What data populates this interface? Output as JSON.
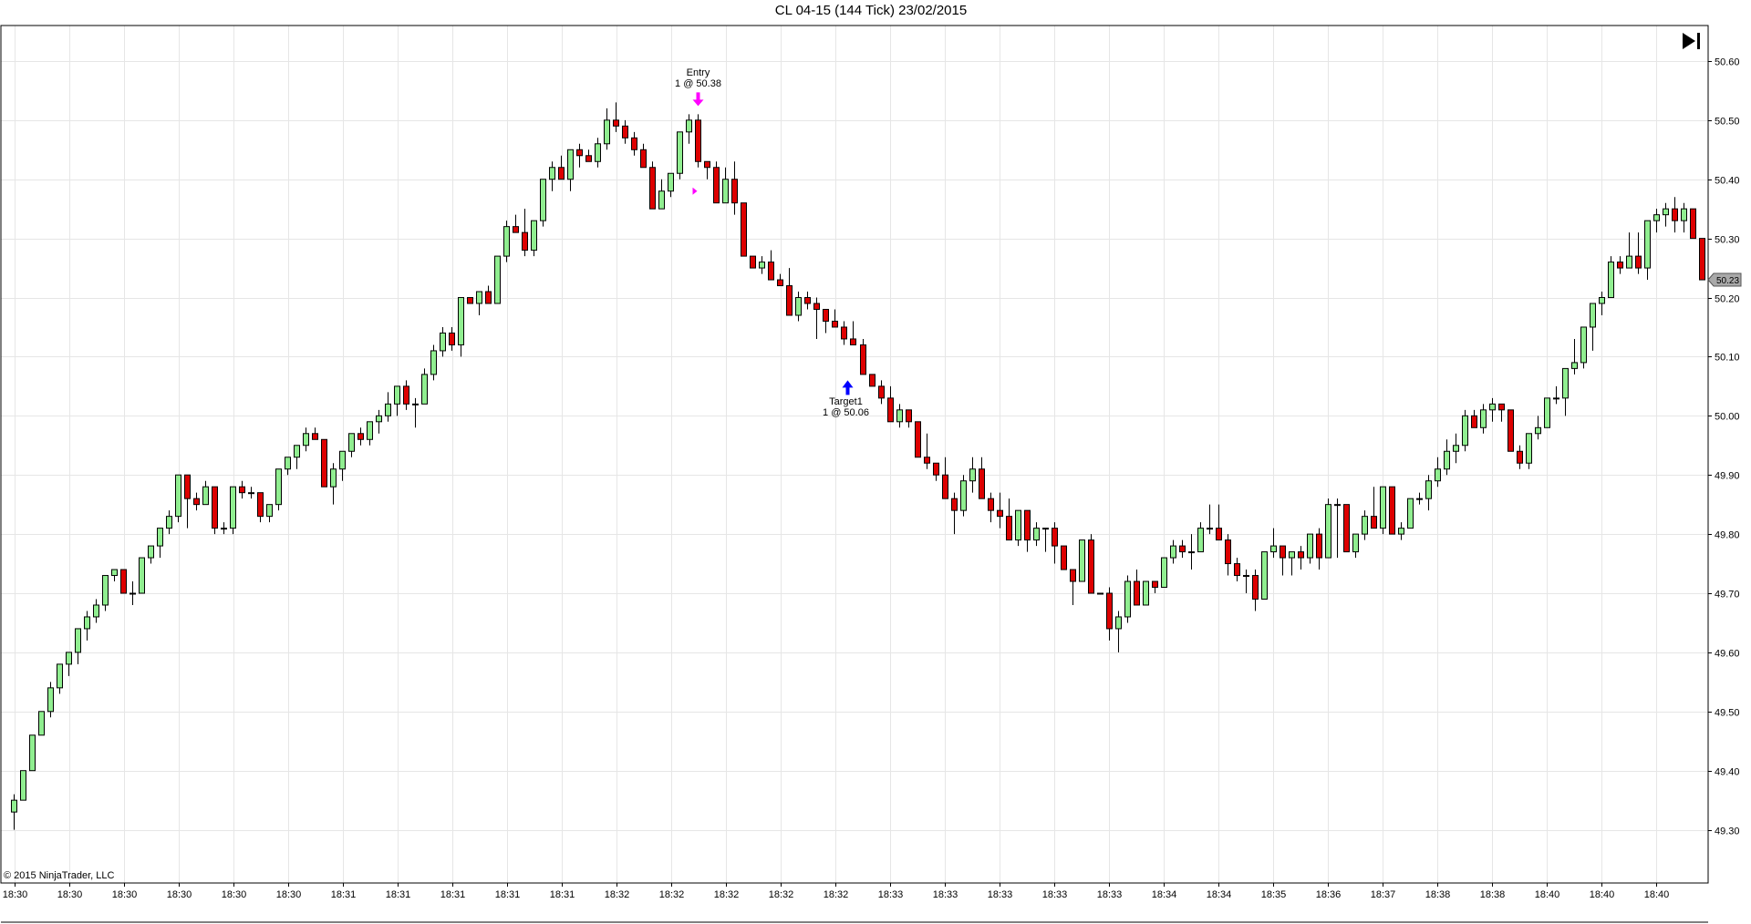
{
  "header": {
    "title": "CL 04-15 (144 Tick)  23/02/2015"
  },
  "footer": {
    "copyright": "© 2015 NinjaTrader, LLC"
  },
  "toolbar": {
    "goto_end_icon": "skip-to-end-icon"
  },
  "colors": {
    "up_candle": "#90ee90",
    "down_candle": "#dd0000",
    "grid": "#e6e6e6",
    "entry_arrow": "#ff00ff",
    "target_arrow": "#0000ff",
    "price_marker": "#a9a9a9"
  },
  "trades": {
    "entry": {
      "line1": "Entry",
      "line2": "1 @ 50.38",
      "price": 50.38
    },
    "target": {
      "line1": "Target1",
      "line2": "1 @ 50.06",
      "price": 50.06
    }
  },
  "chart_data": {
    "type": "candlestick",
    "ylim": [
      49.21,
      50.66
    ],
    "y_ticks": [
      "50.60",
      "50.50",
      "50.40",
      "50.30",
      "50.20",
      "50.10",
      "50.00",
      "49.90",
      "49.80",
      "49.70",
      "49.60",
      "49.50",
      "49.40",
      "49.30"
    ],
    "x_ticks": [
      "18:30",
      "18:30",
      "18:30",
      "18:30",
      "18:30",
      "18:30",
      "18:31",
      "18:31",
      "18:31",
      "18:31",
      "18:31",
      "18:32",
      "18:32",
      "18:32",
      "18:32",
      "18:32",
      "18:33",
      "18:33",
      "18:33",
      "18:33",
      "18:33",
      "18:34",
      "18:34",
      "18:35",
      "18:36",
      "18:37",
      "18:38",
      "18:38",
      "18:40",
      "18:40",
      "18:40"
    ],
    "last_price": "50.23",
    "grid": true,
    "candles": [
      [
        49.33,
        49.36,
        49.3,
        49.35
      ],
      [
        49.35,
        49.4,
        49.35,
        49.4
      ],
      [
        49.4,
        49.46,
        49.4,
        49.46
      ],
      [
        49.46,
        49.5,
        49.46,
        49.5
      ],
      [
        49.5,
        49.55,
        49.49,
        49.54
      ],
      [
        49.54,
        49.58,
        49.53,
        49.58
      ],
      [
        49.58,
        49.6,
        49.56,
        49.6
      ],
      [
        49.6,
        49.64,
        49.58,
        49.64
      ],
      [
        49.64,
        49.67,
        49.62,
        49.66
      ],
      [
        49.66,
        49.69,
        49.65,
        49.68
      ],
      [
        49.68,
        49.73,
        49.67,
        49.73
      ],
      [
        49.73,
        49.74,
        49.72,
        49.74
      ],
      [
        49.74,
        49.74,
        49.7,
        49.7
      ],
      [
        49.7,
        49.72,
        49.68,
        49.7
      ],
      [
        49.7,
        49.76,
        49.7,
        49.76
      ],
      [
        49.76,
        49.78,
        49.75,
        49.78
      ],
      [
        49.78,
        49.81,
        49.76,
        49.81
      ],
      [
        49.81,
        49.84,
        49.8,
        49.83
      ],
      [
        49.83,
        49.9,
        49.82,
        49.9
      ],
      [
        49.9,
        49.9,
        49.81,
        49.86
      ],
      [
        49.86,
        49.87,
        49.84,
        49.85
      ],
      [
        49.85,
        49.89,
        49.85,
        49.88
      ],
      [
        49.88,
        49.88,
        49.8,
        49.81
      ],
      [
        49.81,
        49.82,
        49.8,
        49.81
      ],
      [
        49.81,
        49.88,
        49.8,
        49.88
      ],
      [
        49.88,
        49.89,
        49.86,
        49.87
      ],
      [
        49.87,
        49.88,
        49.86,
        49.87
      ],
      [
        49.87,
        49.87,
        49.82,
        49.83
      ],
      [
        49.83,
        49.85,
        49.82,
        49.85
      ],
      [
        49.85,
        49.91,
        49.84,
        49.91
      ],
      [
        49.91,
        49.93,
        49.9,
        49.93
      ],
      [
        49.93,
        49.95,
        49.91,
        49.95
      ],
      [
        49.95,
        49.98,
        49.94,
        49.97
      ],
      [
        49.97,
        49.98,
        49.96,
        49.96
      ],
      [
        49.96,
        49.96,
        49.88,
        49.88
      ],
      [
        49.88,
        49.92,
        49.85,
        49.91
      ],
      [
        49.91,
        49.94,
        49.89,
        49.94
      ],
      [
        49.94,
        49.97,
        49.93,
        49.97
      ],
      [
        49.97,
        49.98,
        49.95,
        49.96
      ],
      [
        49.96,
        49.99,
        49.95,
        49.99
      ],
      [
        49.99,
        50.01,
        49.97,
        50.0
      ],
      [
        50.0,
        50.04,
        49.99,
        50.02
      ],
      [
        50.02,
        50.05,
        50.0,
        50.05
      ],
      [
        50.05,
        50.06,
        50.01,
        50.02
      ],
      [
        50.02,
        50.03,
        49.98,
        50.02
      ],
      [
        50.02,
        50.08,
        50.02,
        50.07
      ],
      [
        50.07,
        50.12,
        50.06,
        50.11
      ],
      [
        50.11,
        50.15,
        50.1,
        50.14
      ],
      [
        50.14,
        50.15,
        50.11,
        50.12
      ],
      [
        50.12,
        50.2,
        50.1,
        50.2
      ],
      [
        50.2,
        50.2,
        50.19,
        50.19
      ],
      [
        50.19,
        50.21,
        50.17,
        50.21
      ],
      [
        50.21,
        50.22,
        50.19,
        50.19
      ],
      [
        50.19,
        50.27,
        50.19,
        50.27
      ],
      [
        50.27,
        50.33,
        50.26,
        50.32
      ],
      [
        50.32,
        50.34,
        50.31,
        50.31
      ],
      [
        50.31,
        50.35,
        50.27,
        50.28
      ],
      [
        50.28,
        50.33,
        50.27,
        50.33
      ],
      [
        50.33,
        50.4,
        50.32,
        50.4
      ],
      [
        50.4,
        50.43,
        50.38,
        50.42
      ],
      [
        50.42,
        50.44,
        50.4,
        50.4
      ],
      [
        50.4,
        50.45,
        50.38,
        50.45
      ],
      [
        50.45,
        50.46,
        50.42,
        50.44
      ],
      [
        50.44,
        50.45,
        50.43,
        50.43
      ],
      [
        50.43,
        50.47,
        50.42,
        50.46
      ],
      [
        50.46,
        50.52,
        50.45,
        50.5
      ],
      [
        50.5,
        50.53,
        50.48,
        50.49
      ],
      [
        50.49,
        50.5,
        50.46,
        50.47
      ],
      [
        50.47,
        50.48,
        50.44,
        50.45
      ],
      [
        50.45,
        50.46,
        50.43,
        50.42
      ],
      [
        50.42,
        50.43,
        50.35,
        50.35
      ],
      [
        50.35,
        50.4,
        50.35,
        50.38
      ],
      [
        50.38,
        50.41,
        50.37,
        50.41
      ],
      [
        50.41,
        50.48,
        50.4,
        50.48
      ],
      [
        50.48,
        50.51,
        50.46,
        50.5
      ],
      [
        50.5,
        50.51,
        50.42,
        50.43
      ],
      [
        50.43,
        50.43,
        50.4,
        50.42
      ],
      [
        50.42,
        50.43,
        50.36,
        50.36
      ],
      [
        50.36,
        50.42,
        50.36,
        50.4
      ],
      [
        50.4,
        50.43,
        50.34,
        50.36
      ],
      [
        50.36,
        50.36,
        50.27,
        50.27
      ],
      [
        50.27,
        50.27,
        50.25,
        50.25
      ],
      [
        50.25,
        50.27,
        50.24,
        50.26
      ],
      [
        50.26,
        50.28,
        50.23,
        50.23
      ],
      [
        50.23,
        50.24,
        50.22,
        50.22
      ],
      [
        50.22,
        50.25,
        50.17,
        50.17
      ],
      [
        50.17,
        50.21,
        50.16,
        50.2
      ],
      [
        50.2,
        50.21,
        50.18,
        50.19
      ],
      [
        50.19,
        50.2,
        50.13,
        50.18
      ],
      [
        50.18,
        50.18,
        50.14,
        50.16
      ],
      [
        50.16,
        50.18,
        50.15,
        50.15
      ],
      [
        50.15,
        50.16,
        50.12,
        50.13
      ],
      [
        50.13,
        50.16,
        50.12,
        50.12
      ],
      [
        50.12,
        50.13,
        50.07,
        50.07
      ],
      [
        50.07,
        50.07,
        50.05,
        50.05
      ],
      [
        50.05,
        50.06,
        50.02,
        50.03
      ],
      [
        50.03,
        50.05,
        49.99,
        49.99
      ],
      [
        49.99,
        50.02,
        49.98,
        50.01
      ],
      [
        50.01,
        50.01,
        49.98,
        49.99
      ],
      [
        49.99,
        49.99,
        49.93,
        49.93
      ],
      [
        49.93,
        49.97,
        49.91,
        49.92
      ],
      [
        49.92,
        49.92,
        49.89,
        49.9
      ],
      [
        49.9,
        49.93,
        49.86,
        49.86
      ],
      [
        49.86,
        49.87,
        49.8,
        49.84
      ],
      [
        49.84,
        49.9,
        49.83,
        49.89
      ],
      [
        49.89,
        49.93,
        49.87,
        49.91
      ],
      [
        49.91,
        49.93,
        49.86,
        49.86
      ],
      [
        49.86,
        49.87,
        49.82,
        49.84
      ],
      [
        49.84,
        49.87,
        49.81,
        49.83
      ],
      [
        49.83,
        49.86,
        49.79,
        49.79
      ],
      [
        49.79,
        49.84,
        49.78,
        49.84
      ],
      [
        49.84,
        49.84,
        49.77,
        49.79
      ],
      [
        49.79,
        49.82,
        49.78,
        49.81
      ],
      [
        49.81,
        49.81,
        49.77,
        49.81
      ],
      [
        49.81,
        49.82,
        49.75,
        49.78
      ],
      [
        49.78,
        49.78,
        49.74,
        49.74
      ],
      [
        49.74,
        49.74,
        49.68,
        49.72
      ],
      [
        49.72,
        49.79,
        49.72,
        49.79
      ],
      [
        49.79,
        49.8,
        49.7,
        49.7
      ],
      [
        49.7,
        49.7,
        49.7,
        49.7
      ],
      [
        49.7,
        49.71,
        49.62,
        49.64
      ],
      [
        49.64,
        49.67,
        49.6,
        49.66
      ],
      [
        49.66,
        49.73,
        49.65,
        49.72
      ],
      [
        49.72,
        49.74,
        49.68,
        49.68
      ],
      [
        49.68,
        49.72,
        49.68,
        49.72
      ],
      [
        49.72,
        49.72,
        49.7,
        49.71
      ],
      [
        49.71,
        49.76,
        49.71,
        49.76
      ],
      [
        49.76,
        49.79,
        49.75,
        49.78
      ],
      [
        49.78,
        49.79,
        49.76,
        49.77
      ],
      [
        49.77,
        49.8,
        49.74,
        49.77
      ],
      [
        49.77,
        49.82,
        49.77,
        49.81
      ],
      [
        49.81,
        49.85,
        49.8,
        49.81
      ],
      [
        49.81,
        49.85,
        49.8,
        49.79
      ],
      [
        49.79,
        49.8,
        49.73,
        49.75
      ],
      [
        49.75,
        49.76,
        49.72,
        49.73
      ],
      [
        49.73,
        49.74,
        49.7,
        49.73
      ],
      [
        49.73,
        49.74,
        49.67,
        49.69
      ],
      [
        49.69,
        49.77,
        49.69,
        49.77
      ],
      [
        49.77,
        49.81,
        49.76,
        49.78
      ],
      [
        49.78,
        49.78,
        49.73,
        49.76
      ],
      [
        49.76,
        49.77,
        49.73,
        49.77
      ],
      [
        49.77,
        49.78,
        49.74,
        49.76
      ],
      [
        49.76,
        49.8,
        49.75,
        49.8
      ],
      [
        49.8,
        49.81,
        49.74,
        49.76
      ],
      [
        49.76,
        49.86,
        49.76,
        49.85
      ],
      [
        49.85,
        49.86,
        49.76,
        49.85
      ],
      [
        49.85,
        49.85,
        49.78,
        49.77
      ],
      [
        49.77,
        49.8,
        49.76,
        49.8
      ],
      [
        49.8,
        49.84,
        49.79,
        49.83
      ],
      [
        49.83,
        49.88,
        49.81,
        49.81
      ],
      [
        49.81,
        49.85,
        49.8,
        49.88
      ],
      [
        49.88,
        49.88,
        49.8,
        49.8
      ],
      [
        49.8,
        49.82,
        49.79,
        49.81
      ],
      [
        49.81,
        49.86,
        49.81,
        49.86
      ],
      [
        49.86,
        49.87,
        49.85,
        49.86
      ],
      [
        49.86,
        49.9,
        49.84,
        49.89
      ],
      [
        49.89,
        49.93,
        49.88,
        49.91
      ],
      [
        49.91,
        49.96,
        49.9,
        49.94
      ],
      [
        49.94,
        49.97,
        49.92,
        49.95
      ],
      [
        49.95,
        50.01,
        49.94,
        50.0
      ],
      [
        50.0,
        50.01,
        49.99,
        49.98
      ],
      [
        49.98,
        50.02,
        49.97,
        50.01
      ],
      [
        50.01,
        50.03,
        49.99,
        50.02
      ],
      [
        50.02,
        50.02,
        49.99,
        50.01
      ],
      [
        50.01,
        50.01,
        49.94,
        49.94
      ],
      [
        49.94,
        49.95,
        49.91,
        49.92
      ],
      [
        49.92,
        49.97,
        49.91,
        49.97
      ],
      [
        49.97,
        50.0,
        49.96,
        49.98
      ],
      [
        49.98,
        50.03,
        49.98,
        50.03
      ],
      [
        50.03,
        50.05,
        50.02,
        50.03
      ],
      [
        50.03,
        50.08,
        50.0,
        50.08
      ],
      [
        50.08,
        50.13,
        50.07,
        50.09
      ],
      [
        50.09,
        50.11,
        50.08,
        50.15
      ],
      [
        50.15,
        50.19,
        50.11,
        50.19
      ],
      [
        50.19,
        50.21,
        50.17,
        50.2
      ],
      [
        50.2,
        50.27,
        50.2,
        50.26
      ],
      [
        50.26,
        50.27,
        50.24,
        50.25
      ],
      [
        50.25,
        50.31,
        50.25,
        50.27
      ],
      [
        50.27,
        50.31,
        50.24,
        50.25
      ],
      [
        50.25,
        50.33,
        50.23,
        50.33
      ],
      [
        50.33,
        50.35,
        50.31,
        50.34
      ],
      [
        50.34,
        50.36,
        50.32,
        50.35
      ],
      [
        50.35,
        50.37,
        50.31,
        50.33
      ],
      [
        50.33,
        50.36,
        50.31,
        50.35
      ],
      [
        50.35,
        50.35,
        50.3,
        50.3
      ],
      [
        50.3,
        50.3,
        50.23,
        50.23
      ]
    ]
  }
}
